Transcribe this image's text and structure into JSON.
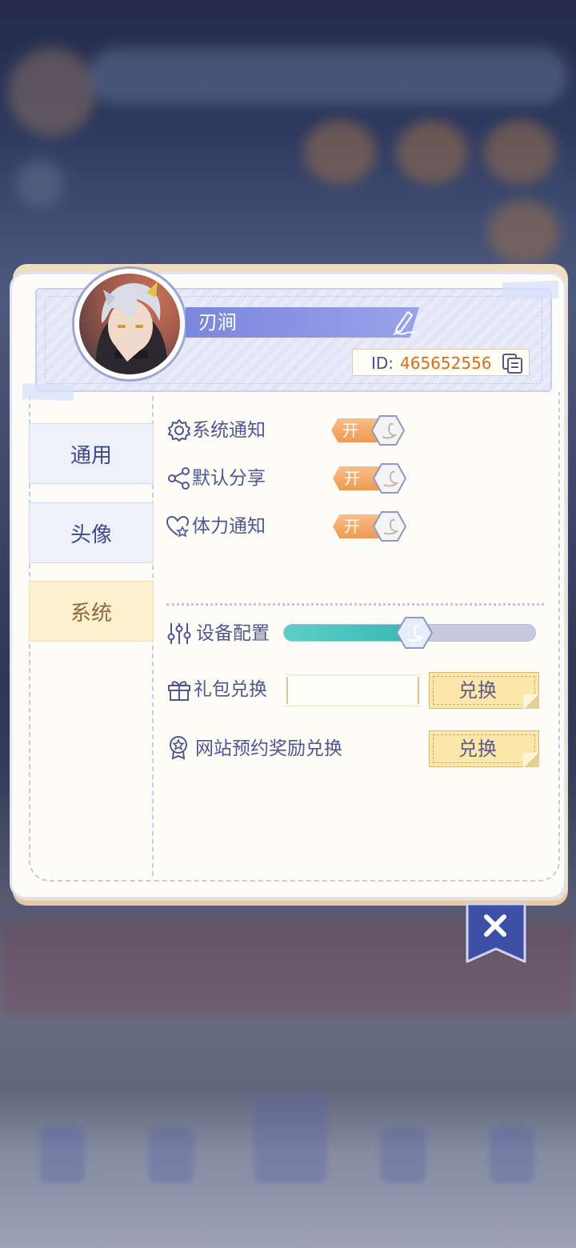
{
  "profile": {
    "name": "刃涧",
    "id_label": "ID:",
    "id_value": "465652556"
  },
  "tabs": [
    {
      "label": "通用",
      "active": false
    },
    {
      "label": "头像",
      "active": false
    },
    {
      "label": "系统",
      "active": true
    }
  ],
  "settings": {
    "toggles": [
      {
        "label": "系统通知",
        "icon": "gear-icon",
        "state_label": "开"
      },
      {
        "label": "默认分享",
        "icon": "share-icon",
        "state_label": "开"
      },
      {
        "label": "体力通知",
        "icon": "heart-icon",
        "state_label": "开"
      }
    ],
    "device_config": {
      "label": "设备配置",
      "icon": "sliders-icon",
      "level": 0.52
    },
    "gift_code": {
      "label": "礼包兑换",
      "icon": "gift-icon",
      "input_value": "",
      "button_label": "兑换"
    },
    "website_reward": {
      "label": "网站预约奖励兑换",
      "icon": "badge-icon",
      "button_label": "兑换"
    }
  },
  "colors": {
    "accent_orange": "#ee9a52",
    "accent_periwinkle": "#7c86dd",
    "slider_teal": "#36b9b3",
    "id_orange": "#d1701e"
  },
  "close_icon": "close-icon"
}
